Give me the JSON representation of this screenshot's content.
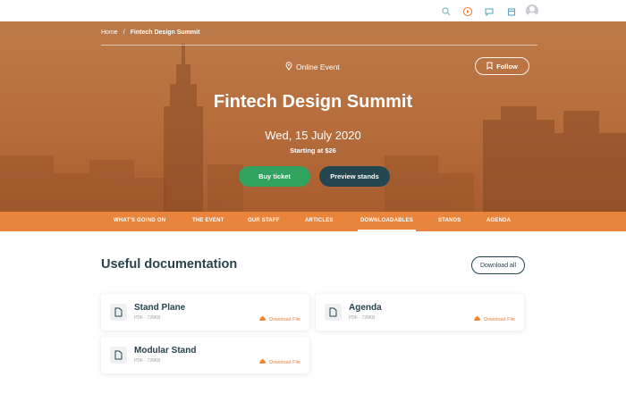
{
  "topbar": {
    "icons": [
      "search-icon",
      "play-icon",
      "chat-icon",
      "calendar-icon",
      "user-avatar"
    ],
    "colors": {
      "search": "#7fb7c4",
      "play": "#e8843c",
      "chat": "#5aa6c8",
      "calendar": "#5aa6c8"
    }
  },
  "breadcrumb": {
    "home": "Home",
    "separator": "/",
    "current": "Fintech Design Summit"
  },
  "hero": {
    "location": "Online Event",
    "follow_label": "Follow",
    "title": "Fintech Design Summit",
    "date": "Wed, 15 July 2020",
    "price": "Starting at $26",
    "buy_label": "Buy ticket",
    "preview_label": "Preview stands"
  },
  "nav": {
    "items": [
      "WHAT'S GOING ON",
      "THE EVENT",
      "OUR STAFF",
      "ARTICLES",
      "DOWNLOADABLES",
      "STANDS",
      "AGENDA"
    ],
    "active": "DOWNLOADABLES"
  },
  "docs": {
    "title": "Useful documentation",
    "download_all": "Download all",
    "cards": [
      {
        "name": "Stand Plane",
        "meta": "PDF - 728KB",
        "action": "Download File"
      },
      {
        "name": "Agenda",
        "meta": "PDF - 728KB",
        "action": "Download File"
      },
      {
        "name": "Modular Stand",
        "meta": "PDF - 728KB",
        "action": "Download File"
      }
    ]
  },
  "colors": {
    "accent": "#e8843c",
    "buy": "#2fa35f",
    "dark": "#234651",
    "heading": "#27434c"
  }
}
